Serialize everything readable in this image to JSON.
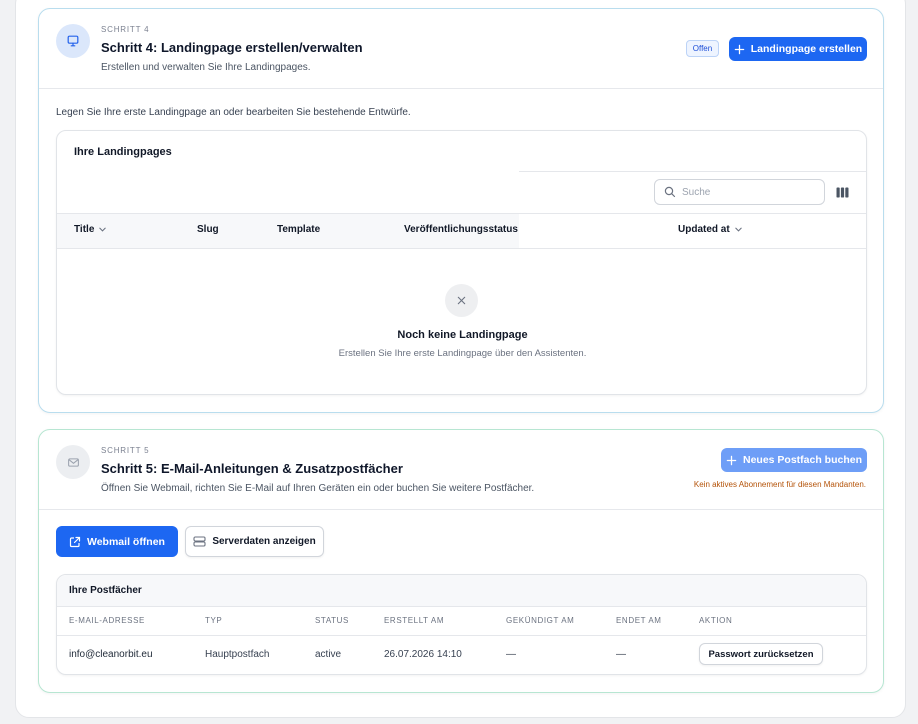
{
  "step4": {
    "eyebrow": "SCHRITT 4",
    "title": "Schritt 4: Landingpage erstellen/verwalten",
    "description": "Erstellen und verwalten Sie Ihre Landingpages.",
    "status_badge": "Offen",
    "create_button": "Landingpage erstellen",
    "intro": "Legen Sie Ihre erste Landingpage an oder bearbeiten Sie bestehende Entwürfe.",
    "table": {
      "title": "Ihre Landingpages",
      "search_placeholder": "Suche",
      "columns": [
        "Title",
        "Slug",
        "Template",
        "Veröffentlichungsstatus",
        "Updated at"
      ],
      "empty_title": "Noch keine Landingpage",
      "empty_desc": "Erstellen Sie Ihre erste Landingpage über den Assistenten."
    }
  },
  "step5": {
    "eyebrow": "SCHRITT 5",
    "title": "Schritt 5: E-Mail-Anleitungen & Zusatzpostfächer",
    "description": "Öffnen Sie Webmail, richten Sie E-Mail auf Ihren Geräten ein oder buchen Sie weitere Postfächer.",
    "book_button": "Neues Postfach buchen",
    "warning": "Kein aktives Abonnement für diesen Mandanten.",
    "webmail_button": "Webmail öffnen",
    "serverdata_button": "Serverdaten anzeigen",
    "mailboxes": {
      "title": "Ihre Postfächer",
      "columns": [
        "E-MAIL-ADRESSE",
        "TYP",
        "STATUS",
        "ERSTELLT AM",
        "GEKÜNDIGT AM",
        "ENDET AM",
        "AKTION"
      ],
      "rows": [
        {
          "email": "info@cleanorbit.eu",
          "type": "Hauptpostfach",
          "status": "active",
          "created": "26.07.2026 14:10",
          "cancelled": "—",
          "ends": "—",
          "action": "Passwort zurücksetzen"
        }
      ]
    }
  },
  "colors": {
    "primary": "#1d67f2",
    "primary_disabled": "#6e9ef7",
    "warning": "#b45309",
    "step4_border": "#b9ddee",
    "step5_border": "#b7e6d2"
  }
}
